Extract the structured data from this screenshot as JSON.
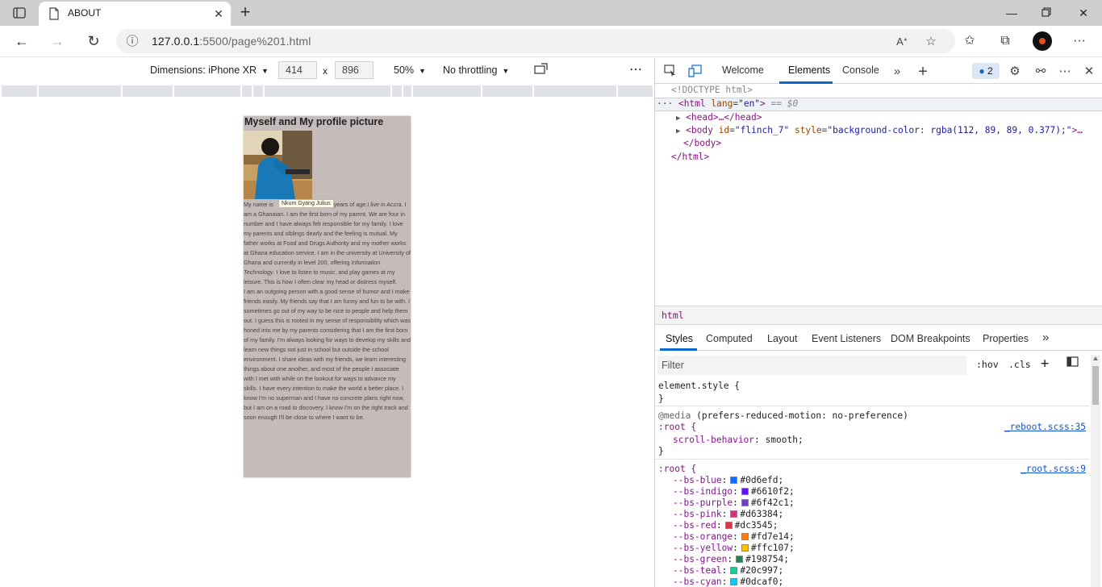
{
  "browser": {
    "tab_title": "ABOUT",
    "url_host": "127.0.0.1",
    "url_path": ":5500/page%201.html"
  },
  "device_toolbar": {
    "dimensions_label": "Dimensions: iPhone XR",
    "width": "414",
    "height": "896",
    "separator": "x",
    "zoom": "50%",
    "throttling": "No throttling"
  },
  "page": {
    "heading": "Myself and My profile picture",
    "tooltip": "Nkum Gyang Julius",
    "bio_1_pre": "My name is ",
    "bio_1_mid": ". I am 20 years of age.I live in Accra. I am a Ghanaian. I am the first born of my parent. We are four in number and I have always felt responsible for my family. I love my parents and siblings dearly and the feeling is mutual. My father works at Food and Drugs Authority and my mother works at Ghana education service. I am in the university at University of Ghana and currently in level 200, offering ",
    "bio_1_italic": "Information Technology",
    "bio_1_post": ". I love to listen to music, and play games at my leisure. This is how I often clear my head or distress myself.",
    "bio_2": "I am an outgoing person with a good sense of humor and I make friends easily. My friends say that I am funny and fun to be with. I sometimes go out of my way to be nice to people and help them out. I guess this is rooted in my sense of responsibility which was honed into me by my parents considering that I am the first born of my family. I'm always looking for ways to develop my skills and learn new things not just in school but outside the school environment. I share ideas with my friends, we learn interesting things about one another, and most of the people I associate with I met with while on the lookout for ways to advance my skills. I have every intention to make the world a better place. I know I'm no superman and I have no concrete plans right now, but I am on a road to discovery. I know I'm on the right track and soon enough I'll be close to where I want to be."
  },
  "devtools": {
    "tabs": {
      "welcome": "Welcome",
      "elements": "Elements",
      "console": "Console"
    },
    "issues_count": "2",
    "dom": {
      "doctype": "<!DOCTYPE html>",
      "html_open_tag": "<html",
      "html_lang_attr": "lang",
      "html_lang_val": "\"en\"",
      "html_close_bracket": ">",
      "html_eq_ref": "== $0",
      "head_line": "<head>…</head>",
      "body_open_tag": "<body",
      "body_id_attr": "id",
      "body_id_val": "\"flinch_7\"",
      "body_style_attr": "style",
      "body_style_val": "\"background-color: rgba(112, 89, 89, 0.377);\"",
      "body_tail": ">…",
      "body_close": "</body>",
      "html_close": "</html>"
    },
    "breadcrumb": "html",
    "sub_tabs": {
      "styles": "Styles",
      "computed": "Computed",
      "layout": "Layout",
      "event_listeners": "Event Listeners",
      "dom_breakpoints": "DOM Breakpoints",
      "properties": "Properties"
    },
    "filter_placeholder": "Filter",
    "hov": ":hov",
    "cls": ".cls",
    "styles": {
      "element_style": "element.style {",
      "close_brace": "}",
      "media_keyword": "@media",
      "media_query": "(prefers-reduced-motion: no-preference)",
      "root_selector": ":root {",
      "reboot_source": "_reboot.scss:35",
      "scroll_prop": "scroll-behavior",
      "scroll_val": "smooth;",
      "root_source": "_root.scss:9",
      "vars": [
        {
          "name": "--bs-blue",
          "value": "#0d6efd;",
          "color": "#0d6efd"
        },
        {
          "name": "--bs-indigo",
          "value": "#6610f2;",
          "color": "#6610f2"
        },
        {
          "name": "--bs-purple",
          "value": "#6f42c1;",
          "color": "#6f42c1"
        },
        {
          "name": "--bs-pink",
          "value": "#d63384;",
          "color": "#d63384"
        },
        {
          "name": "--bs-red",
          "value": "#dc3545;",
          "color": "#dc3545"
        },
        {
          "name": "--bs-orange",
          "value": "#fd7e14;",
          "color": "#fd7e14"
        },
        {
          "name": "--bs-yellow",
          "value": "#ffc107;",
          "color": "#ffc107"
        },
        {
          "name": "--bs-green",
          "value": "#198754;",
          "color": "#198754"
        },
        {
          "name": "--bs-teal",
          "value": "#20c997;",
          "color": "#20c997"
        },
        {
          "name": "--bs-cyan",
          "value": "#0dcaf0;",
          "color": "#0dcaf0"
        }
      ]
    }
  },
  "colors": {
    "accent": "#0a69c8",
    "page_bg": "#c6bbbb",
    "tag": "#881280"
  }
}
